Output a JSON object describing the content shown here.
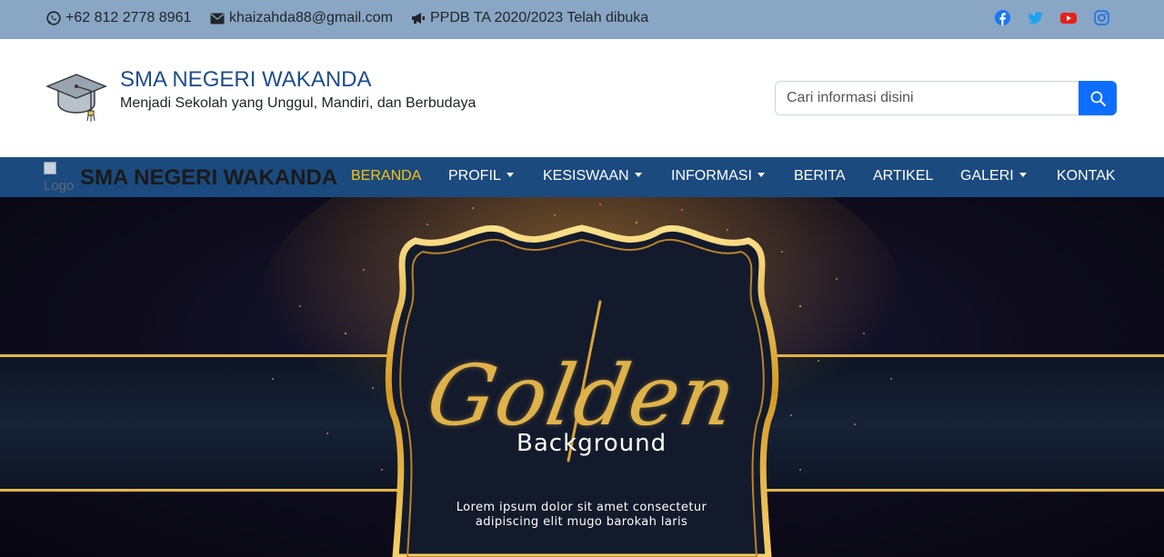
{
  "topbar": {
    "phone": "+62 812 2778 8961",
    "email": "khaizahda88@gmail.com",
    "announcement": "PPDB TA 2020/2023 Telah dibuka",
    "social": [
      {
        "icon": "facebook-icon",
        "color": "#1877f2"
      },
      {
        "icon": "twitter-icon",
        "color": "#1da1f2"
      },
      {
        "icon": "youtube-icon",
        "color": "#e62117"
      },
      {
        "icon": "instagram-icon",
        "color": "#1a73e8"
      }
    ]
  },
  "header": {
    "title": "SMA NEGERI WAKANDA",
    "tagline": "Menjadi Sekolah yang Unggul, Mandiri, dan Berbudaya",
    "search_placeholder": "Cari informasi disini",
    "logo_icon": "graduation-cap-icon"
  },
  "navbar": {
    "logo_alt": "Logo",
    "brand": "SMA NEGERI WAKANDA",
    "items": [
      {
        "label": "BERANDA",
        "active": true,
        "dropdown": false
      },
      {
        "label": "PROFIL",
        "active": false,
        "dropdown": true
      },
      {
        "label": "KESISWAAN",
        "active": false,
        "dropdown": true
      },
      {
        "label": "INFORMASI",
        "active": false,
        "dropdown": true
      },
      {
        "label": "BERITA",
        "active": false,
        "dropdown": false
      },
      {
        "label": "ARTIKEL",
        "active": false,
        "dropdown": false
      },
      {
        "label": "GALERI",
        "active": false,
        "dropdown": true
      },
      {
        "label": "KONTAK",
        "active": false,
        "dropdown": false
      }
    ],
    "accent_color": "#ffc107",
    "bg_color": "#1b4a7e"
  },
  "hero": {
    "script_word": "Golden",
    "sub_word": "Background",
    "line1": "Lorem ipsum dolor sit amet consectetur",
    "line2": "adipiscing elit mugo barokah laris"
  }
}
